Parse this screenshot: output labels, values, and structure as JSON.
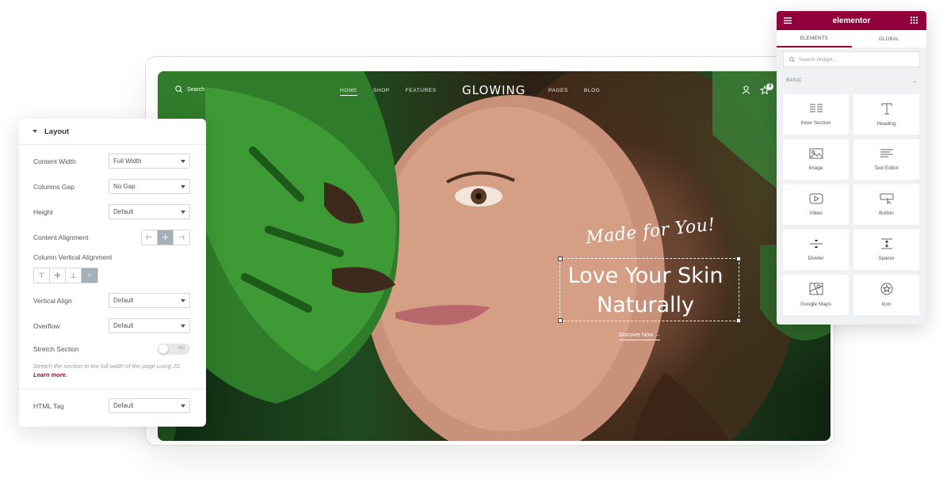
{
  "hero": {
    "search_label": "Search",
    "nav_left": [
      "HOME",
      "SHOP",
      "FEATURES"
    ],
    "brand": "GLOWING",
    "nav_right": [
      "PAGES",
      "BLOG"
    ],
    "cart_count": "3",
    "script_text": "Made for You!",
    "headline_line1": "Love Your Skin",
    "headline_line2": "Naturally",
    "cta": "Discover Now →"
  },
  "layout_panel": {
    "title": "Layout",
    "content_width": {
      "label": "Content Width",
      "value": "Full Width"
    },
    "columns_gap": {
      "label": "Columns Gap",
      "value": "No Gap"
    },
    "height": {
      "label": "Height",
      "value": "Default"
    },
    "content_alignment": {
      "label": "Content Alignment"
    },
    "column_vertical_alignment": {
      "label": "Column Vertical Alignment"
    },
    "vertical_align": {
      "label": "Vertical Align",
      "value": "Default"
    },
    "overflow": {
      "label": "Overflow",
      "value": "Default"
    },
    "stretch_section": {
      "label": "Stretch Section",
      "toggle": "NO"
    },
    "stretch_note": "Stretch the section to the full width of the page using JS.",
    "learn_more": "Learn more.",
    "html_tag": {
      "label": "HTML Tag",
      "value": "Default"
    }
  },
  "widget_panel": {
    "brand": "elementor",
    "tabs": [
      "ELEMENTS",
      "GLOBAL"
    ],
    "search_placeholder": "Search Widget...",
    "category": "BASIC",
    "widgets": [
      {
        "label": "Inner Section",
        "icon": "inner-section-icon"
      },
      {
        "label": "Heading",
        "icon": "heading-icon"
      },
      {
        "label": "Image",
        "icon": "image-icon"
      },
      {
        "label": "Text Editor",
        "icon": "text-editor-icon"
      },
      {
        "label": "Video",
        "icon": "video-icon"
      },
      {
        "label": "Button",
        "icon": "button-icon"
      },
      {
        "label": "Divider",
        "icon": "divider-icon"
      },
      {
        "label": "Spacer",
        "icon": "spacer-icon"
      },
      {
        "label": "Google Maps",
        "icon": "google-maps-icon"
      },
      {
        "label": "Icon",
        "icon": "icon-widget-icon"
      }
    ],
    "accent_color": "#92003b"
  }
}
